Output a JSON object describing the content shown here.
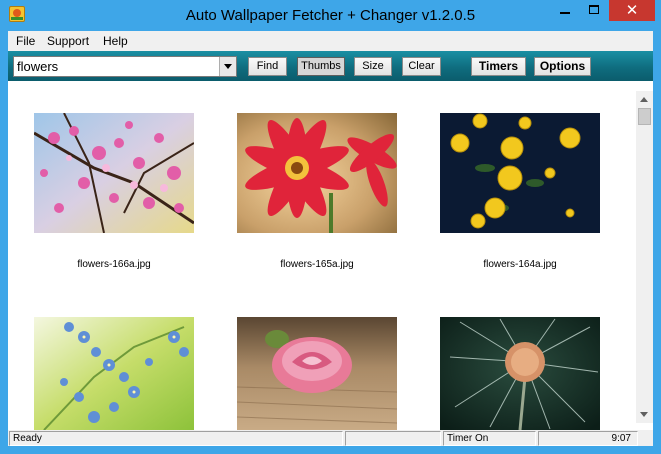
{
  "window": {
    "title": "Auto Wallpaper Fetcher + Changer v1.2.0.5",
    "icon": "app-icon",
    "controls": {
      "minimize": "minimize-icon",
      "maximize": "maximize-icon",
      "close_glyph": "✕"
    }
  },
  "menu": {
    "items": [
      {
        "label": "File"
      },
      {
        "label": "Support"
      },
      {
        "label": "Help"
      }
    ]
  },
  "toolbar": {
    "search_value": "flowers",
    "find_label": "Find",
    "thumbs_label": "Thumbs",
    "size_label": "Size",
    "clear_label": "Clear",
    "timers_label": "Timers",
    "options_label": "Options",
    "accent_color": "#0f6d7f"
  },
  "gallery": {
    "items": [
      {
        "filename": "flowers-166a.jpg",
        "subject": "pink blossom branches"
      },
      {
        "filename": "flowers-165a.jpg",
        "subject": "red gerbera with dew"
      },
      {
        "filename": "flowers-164a.jpg",
        "subject": "yellow roses on dark"
      },
      {
        "filename": "",
        "subject": "blue forget-me-nots"
      },
      {
        "filename": "",
        "subject": "pink rose on wood"
      },
      {
        "filename": "",
        "subject": "dandelion seed head"
      }
    ]
  },
  "status": {
    "state": "Ready",
    "timer": "Timer On",
    "time": "9:07"
  }
}
